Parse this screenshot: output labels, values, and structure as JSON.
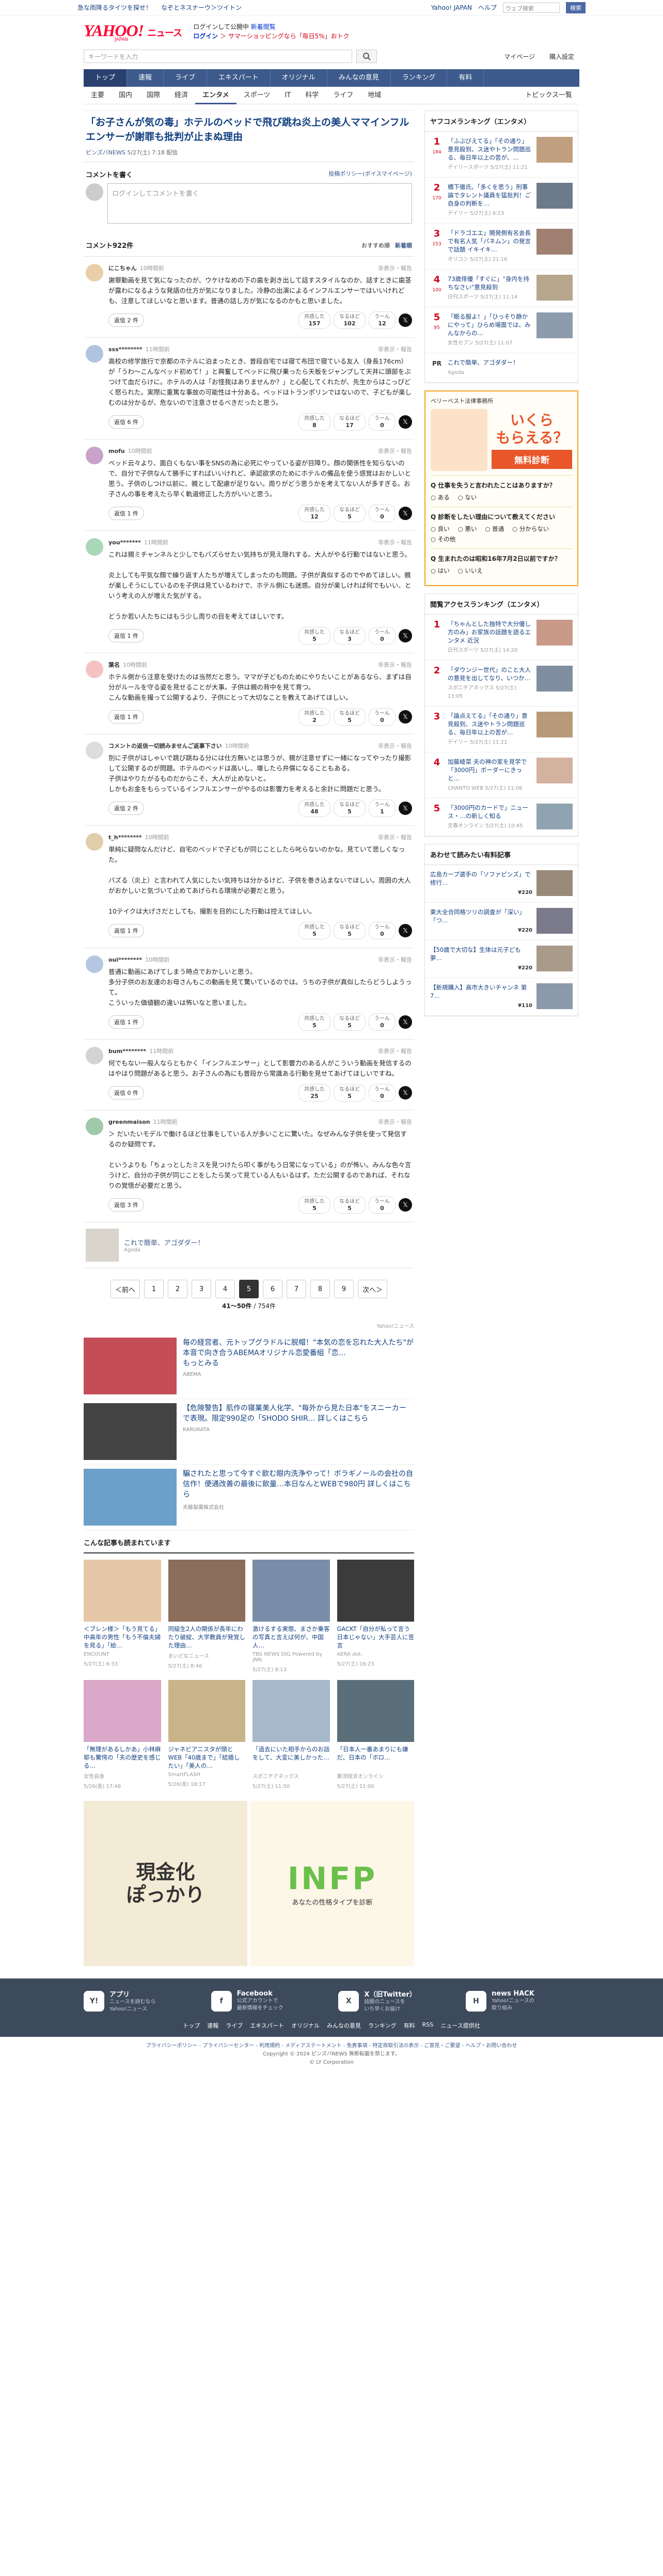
{
  "topstrip": {
    "left": [
      "急な雨降るタイツを探せ！",
      "なぞとネスナーウ＞ツイトン"
    ],
    "right": [
      "Yahoo! JAPAN",
      "ヘルプ"
    ],
    "search_placeholder": "ウェブ検索",
    "search_btn": "検索"
  },
  "header": {
    "logo": "YAHOO!",
    "logo_suffix": "ニュース",
    "logo_sub": "JAPAN",
    "line1": "ログインして公開中 ",
    "line1_link": "新着閲覧",
    "login": "ログイン",
    "line2": "＞ サマーショッピングなら「毎日5%」おトク"
  },
  "search": {
    "placeholder": "キーワードを入力",
    "links": [
      "マイページ",
      "購入設定"
    ]
  },
  "nav1": [
    "トップ",
    "速報",
    "ライブ",
    "エキスパート",
    "オリジナル",
    "みんなの意見",
    "ランキング",
    "有料"
  ],
  "nav2": [
    "主要",
    "国内",
    "国際",
    "経済",
    "エンタメ",
    "スポーツ",
    "IT",
    "科学",
    "ライフ",
    "地域"
  ],
  "nav2_active": "エンタメ",
  "nav2_right": "トピックス一覧",
  "article": {
    "title": "「お子さんが気の毒」ホテルのベッドで飛び跳ね炎上の美人ママインフルエンサーが謝罪も批判が止まぬ理由",
    "source": "ピンズバNEWS",
    "date": "5/27(土) 7:18",
    "status": "配信"
  },
  "write": {
    "heading": "コメントを書く",
    "policy": "投稿ポリシー(ボイスマイページ)",
    "placeholder": "ログインしてコメントを書く"
  },
  "comments_head": {
    "count": "コメント922件",
    "sort_a": "おすすめ順",
    "sort_b": "新着順"
  },
  "comments": [
    {
      "name": "にこちゃん",
      "time": "10時間前",
      "text": "謝罪動画を見て気になったのが、ウケけなめの下の歯を剥き出して話すスタイルなのか、話すときに歯茎が露わになるような発語の仕方が気になりました。冷静の出演によるインフルエンサーではいいけれども、注意してほしいなと思います。普通の話し方が気になるのかもと思いました。",
      "reply": "返信 2 件",
      "agree": "157",
      "gonna": "102",
      "down": "12",
      "color": "#e8cfa8"
    },
    {
      "name": "sss********",
      "time": "11時間前",
      "text": "高校の修学旅行で京都のホテルに泊まったとき、普段自宅では寝て布団で寝ている友人（身長176cm）が「うわ〜こんなベッド初めて！」と興奮してベッドに飛び乗ったら天板をジャンプして天井に頭部をぶつけて血だらけに。ホテルの人は「お怪我はありませんか？」と心配してくれたが、先生からはこっぴどく怒られた。実際に重篤な事故の可能性は十分ある。ベッドはトランポリンではないので、子どもが楽しむのは分かるが、危ないので注意させるべきだったと思う。",
      "reply": "返信 6 件",
      "agree": "8",
      "gonna": "17",
      "down": "0",
      "color": "#b0c4de"
    },
    {
      "name": "mofu",
      "time": "10時間前",
      "text": "ベッド云々より、面白くもない事をSNSの為に必死にやっている姿が目障り。顔の関係性を知らないので、自分で子供なんて勝手にすればいいけれど、承認欲求のためにホテルの備品を使う感覚はおかしいと思う。子供のしつけ以前に、親として配慮が足りない。周りがどう思うかを考えてない人が多すぎる。お子さんの事を考えたら早く軌道修正した方がいいと思う。",
      "reply": "返信 1 件",
      "agree": "12",
      "gonna": "5",
      "down": "0",
      "color": "#c8a2c8"
    },
    {
      "name": "you*******",
      "time": "11時間前",
      "text": "これは親ミチャンネルと少しでもバズらせたい気持ちが見え隠れする。大人がやる行動ではないと思う。\n\n炎上しても平気な顔で繰り返す人たちが増えてしまったのも問題。子供が真似するのでやめてほしい。親が楽しそうにしているのを子供は見ているわけで、ホテル側にも迷惑。自分が楽しければ何でもいい、という考えの人が増えた気がする。\n\nどうか若い人たちにはもう少し周りの目を考えてほしいです。",
      "reply": "返信 1 件",
      "agree": "5",
      "gonna": "3",
      "down": "0",
      "color": "#a8d8b9"
    },
    {
      "name": "葉名",
      "time": "10時間前",
      "text": "ホテル側から注意を受けたのは当然だと思う。ママが子どものためにやりたいことがあるなら、まずは自分がルールを守る姿を見せることが大事。子供は親の背中を見て育つ。\nこんな動画を撮って公開するより、子供にとって大切なことを教えてあげてほしい。",
      "reply": "返信 1 件",
      "agree": "2",
      "gonna": "5",
      "down": "0",
      "color": "#f4c2c2"
    },
    {
      "name": "コメントの返信一切読みませんご返事下さい",
      "time": "10時間前",
      "text": "別に子供がはしゃいで跳び跳ねる分には仕方無いとは思うが、親が注意せずに一緒になってやったり撮影して公開するのが問題。ホテルのベッドは高いし、壊したら弁償になることもある。\n子供はやりたがるものだからこそ、大人が止めないと。\nしかもお金をもらっているインフルエンサーがやるのは影響力を考えると余計に問題だと思う。",
      "reply": "返信 2 件",
      "agree": "48",
      "gonna": "5",
      "down": "1",
      "color": "#ddd"
    },
    {
      "name": "t_h********",
      "time": "10時間前",
      "text": "単純に疑問なんだけど、自宅のベッドで子どもが同じことしたら叱らないのかな。見ていて悲しくなった。\n\nバズる（炎上）と言われて人気にしたい気持ちは分かるけど、子供を巻き込まないでほしい。周囲の大人がおかしいと気づいて止めてあげられる環境が必要だと思う。\n\n10テイクは大げさだとしても、撮影を目的にした行動は控えてほしい。",
      "reply": "返信 1 件",
      "agree": "5",
      "gonna": "5",
      "down": "0",
      "color": "#e0cda9"
    },
    {
      "name": "oui********",
      "time": "10時間前",
      "text": "普通に動画にあげてしまう時点でおかしいと思う。\n多分子供のお友達のお母さんもこの動画を見て驚いているのでは。うちの子供が真似したらどうしようって。\nこういった価値観の違いは怖いなと思いました。",
      "reply": "返信 1 件",
      "agree": "5",
      "gonna": "5",
      "down": "0",
      "color": "#b5c7e0"
    },
    {
      "name": "bum********",
      "time": "11時間前",
      "text": "何でもない一般人ならともかく「インフルエンサー」として影響力のある人がこういう動画を発信するのはやはり問題があると思う。お子さんの為にも普段から常識ある行動を見せてあげてほしいですね。",
      "reply": "返信 0 件",
      "agree": "25",
      "gonna": "5",
      "down": "0",
      "color": "#d3d3d3"
    },
    {
      "name": "greenmaison",
      "time": "11時間前",
      "text": "＞ だいたいモデルで働けるほど仕事をしている人が多いことに驚いた。なぜみんな子供を使って発信するのか疑問です。\n\nというよりも「ちょっとしたミスを見つけたら叩く事がもう日常になっている」のが怖い。みんな色々言うけど、自分の子供が同じことをしたら笑って見ている人もいるはず。ただ公開するのであれば、それなりの覚悟が必要だと思う。",
      "reply": "返信 3 件",
      "agree": "5",
      "gonna": "5",
      "down": "0",
      "color": "#9fc9a8"
    }
  ],
  "vote_labels": {
    "agree": "共感した",
    "gonna": "なるほど",
    "down": "うーん"
  },
  "report_label": "非表示・報告",
  "expert": {
    "title": "これで簡単、アゴダダー！",
    "sponsor": "Agoda"
  },
  "pager": {
    "prev": "＜前へ",
    "next": "次へ＞",
    "pages": [
      "1",
      "2",
      "3",
      "4",
      "5",
      "6",
      "7",
      "8",
      "9"
    ],
    "current": "5",
    "info": "41〜50件",
    "info_total": "/ 754件"
  },
  "ads_label": "Yahoo!ニュース",
  "ads": [
    {
      "title": "毎の経営者、元トップグラドルに脱帽！\"本気の恋を忘れた大人たち\"が本音で向き合うABEMAオリジナル恋愛番組「恋…",
      "sub": "もっとみる",
      "sponsor": "ABEMA",
      "color": "#c44d58"
    },
    {
      "title": "【危険警告】肌作の寝業美人化学、\"毎外から見た日本\"をスニーカー で表現。限定990足の「SHODO SHIR… 詳しくはこちら",
      "sponsor": "KARUKATA",
      "color": "#444"
    },
    {
      "title": "騙されたと思って今すぐ飲む眼内洗浄やって！ボラギノールの会社の自信作！便通改善の最後に飲量…本日なんとWEBで980円 詳しくはこちら",
      "sponsor": "天藤製薬株式会社",
      "color": "#6aa0c9"
    }
  ],
  "related": {
    "title": "こんな記事も読まれています",
    "items": [
      {
        "t": "＜ブレン様＞「もう見てる」中高年の男性「もう不倫夫婦を見る」「絵…",
        "m": "ENCOUNT",
        "d": "5/27(土) 6:33",
        "c": "#e6c7a8"
      },
      {
        "t": "同級生2人の関係が長年にわたり破綻、大学教員が発覚した理由…",
        "m": "まいどなニュース",
        "d": "5/27(土) 8:46",
        "c": "#8a6d5a"
      },
      {
        "t": "激けるする実態、まさか乗客の写真と言えば何が、中国人…",
        "m": "TBS NEWS DIG Powered by JNN",
        "d": "5/27(土) 8:13",
        "c": "#7a8da8"
      },
      {
        "t": "GACKT「自分が私って言う日本じゃない」大手芸人に苦言",
        "m": "AERA dot.",
        "d": "5/27(土) 16:23",
        "c": "#3b3b3b"
      },
      {
        "t": "「無理があるしかあ」小林麻耶も驚愕の「夫の歴史を感じる…",
        "m": "女性自身",
        "d": "5/26(金) 17:48",
        "c": "#d9a7c7"
      },
      {
        "t": "ジャネビアニスタが頭とWEB「40歳まで」「結婚したい」「美人の…",
        "m": "SmartFLASH",
        "d": "5/26(金) 18:17",
        "c": "#c9b48a"
      },
      {
        "t": "「過去にいた相手からのお話をして、大変に美しかった…",
        "m": "スポニチアネックス",
        "d": "5/27(土) 11:50",
        "c": "#a6b8c9"
      },
      {
        "t": "「日本人一番あまりにも嫌だ、日本の「ボロ…",
        "m": "東洋経済オンライン",
        "d": "5/27(土) 11:00",
        "c": "#5a6f7a"
      }
    ]
  },
  "bottom_ad": {
    "left": "現金化\nぽっかり",
    "right_big": "INFP",
    "right_small": "あなたの性格タイプを診断"
  },
  "side": {
    "ranking_title": "ヤフコメランキング（エンタメ）",
    "ranking": [
      {
        "n": "1",
        "c": "184",
        "t": "「ふぶびえてる」「その通り」意見殺到、ス迷やトラン問題巡る、毎日年以上の苦が、…",
        "m": "デイリースポーツ 5/27(土) 11:21",
        "col": "#c0a080"
      },
      {
        "n": "2",
        "c": "170",
        "t": "橋下徹氏、「多くを思う」刑事論でタレント議員を猛批判！ご自身の判断を…",
        "m": "デイリー 5/27(土) 9:23",
        "col": "#6d7a8a"
      },
      {
        "n": "3",
        "c": "153",
        "t": "「ドラゴエエ」開発側有名会長で有名人気「パネムン」の発言で話題 イキイキ…",
        "m": "オリコン 5/27(土) 21:16",
        "col": "#a08070"
      },
      {
        "n": "4",
        "c": "100",
        "t": "73歳俳優「すぐに」\"身内を持ちなさい\"意見殺到",
        "m": "日刊スポーツ 5/27(土) 11:14",
        "col": "#b5a68c"
      },
      {
        "n": "5",
        "c": "95",
        "t": "「眠る服よ！」「ひっそり静かにやって」ひらめ場面では、みんなからの…",
        "m": "女性セブン 5/27(土) 11:07",
        "col": "#8c9cad"
      }
    ],
    "pr": {
      "t": "これで簡単、アゴダダー！",
      "s": "Agoda"
    },
    "survey": {
      "brand": "ベリーベスト法律事務所",
      "cta_big": "いくら\nもらえる？",
      "cta_btn": "無料診断",
      "q1": "Q 仕事を失うと言われたことはありますか？",
      "q1_opts": [
        "ある",
        "ない"
      ],
      "q2": "Q 診断をしたい理由について教えてください",
      "q2_opts": [
        "良い",
        "悪い",
        "普通",
        "分からない",
        "その他"
      ],
      "q3": "Q 生まれたのは昭和16年7月2日以前ですか？",
      "q3_opts": [
        "はい",
        "いいえ"
      ]
    },
    "access_title": "閲覧アクセスランキング（エンタメ）",
    "access": [
      {
        "n": "1",
        "t": "「ちゃんとした独特で大分優し方のみ」お家族の話題を語るエンタメ 近況",
        "m": "日刊スポーツ 5/27(土) 14:20",
        "col": "#c99a88"
      },
      {
        "n": "2",
        "t": "「ダウンジー世代」のこと大人の意見を出してなり、いつか…",
        "m": "スポニチアネックス 5/27(土) 13:05",
        "col": "#7f8ea0"
      },
      {
        "n": "3",
        "t": "「論点えてる」「その通り」意見殺到、ス迷やトラン問題巡る、毎日年以上の苦が…",
        "m": "デイリー 5/27(土) 11:21",
        "col": "#b89a7a"
      },
      {
        "n": "4",
        "t": "加藤綾菜 夫の神の家を見学で「3000円」ボーダーにきっと…",
        "m": "CHANTO WEB 5/27(土) 11:08",
        "col": "#d4b2a0"
      },
      {
        "n": "5",
        "t": "「3000円のカードで」ニュース・…の新しく知る",
        "m": "文春オンライン 5/27(土) 10:45",
        "col": "#8fa3b0"
      }
    ],
    "paid_title": "あわせて読みたい有料記事",
    "paid": [
      {
        "t": "広島カープ選手の「ソファピンズ」で修行…",
        "p": "¥220",
        "col": "#9a8a7a"
      },
      {
        "t": "東大全合同格ツリの調査が「深い」「つ…",
        "p": "¥220",
        "col": "#7a7a8a"
      },
      {
        "t": "【50歳で大切な】生体は元子ども夢…",
        "p": "¥220",
        "col": "#aa9a8a"
      },
      {
        "t": "【新規購入】高市大きいチャンネ 第7…",
        "p": "¥110",
        "col": "#8a9aaa"
      }
    ]
  },
  "footer": {
    "apps": [
      {
        "ic": "Y!",
        "name": "アプリ",
        "desc": "ニュースを読むなら\nYahoo!ニュース"
      },
      {
        "ic": "f",
        "name": "Facebook",
        "desc": "公式アカウントで\n最新情報をチェック"
      },
      {
        "ic": "X",
        "name": "X（旧Twitter）",
        "desc": "話題のニュースを\nいち早くお届け"
      },
      {
        "ic": "H",
        "name": "news HACK",
        "desc": "Yahoo!ニュースの\n取り組み"
      }
    ],
    "links": [
      "トップ",
      "速報",
      "ライブ",
      "エキスパート",
      "オリジナル",
      "みんなの意見",
      "ランキング",
      "有料",
      "RSS",
      "ニュース提供社"
    ]
  },
  "copy": {
    "links": "プライバシーポリシー - プライバシーセンター - 利用規約 - メディアステートメント - 免責事項 - 特定商取引法の表示 - ご意見・ご要望 - ヘルプ・お問い合わせ",
    "line2": "Copyright © 2024 ピンズバNEWS 無断転載を禁じます。",
    "line3": "© LY Corporation"
  }
}
